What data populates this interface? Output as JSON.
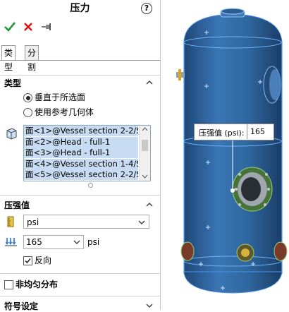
{
  "panel": {
    "title": "压力",
    "help_label": "?",
    "tabs": [
      "类型",
      "分割"
    ],
    "type_section": {
      "heading": "类型",
      "options": [
        "垂直于所选面",
        "使用参考几何体"
      ],
      "faces": [
        "面<1>@Vessel section 2-2/S",
        "面<2>@Head - full-1",
        "面<3>@Head - full-1",
        "面<4>@Vessel section 1-4/S",
        "面<5>@Vessel section 2-2/S"
      ]
    },
    "pressure_section": {
      "heading": "压强值",
      "unit_select": "psi",
      "value": "165",
      "unit_label": "psi",
      "reverse_label": "反向"
    },
    "nonuniform_label": "非均匀分布",
    "symbol_settings_label": "符号设定"
  },
  "callout": {
    "label": "压强值 (psi):",
    "value": "165"
  },
  "colors": {
    "vessel": "#2c5f96",
    "accent": "#1a6fd0"
  }
}
